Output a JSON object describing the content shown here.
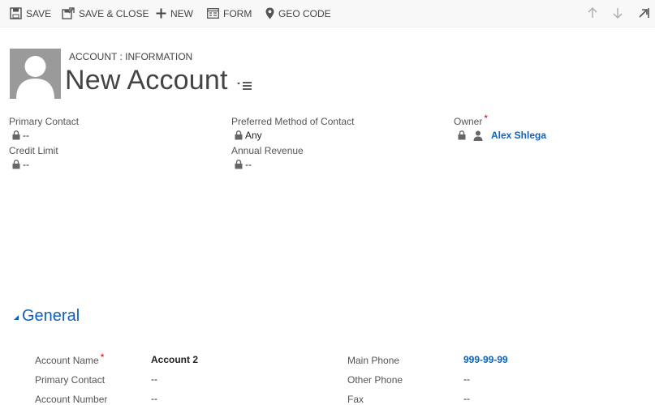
{
  "toolbar": {
    "save": "SAVE",
    "save_close": "SAVE & CLOSE",
    "new": "NEW",
    "form": "FORM",
    "geo_code": "GEO CODE"
  },
  "header": {
    "entity_label": "ACCOUNT : INFORMATION",
    "title": "New Account",
    "fields": {
      "primary_contact": {
        "label": "Primary Contact",
        "value": "--"
      },
      "preferred_method": {
        "label": "Preferred Method of Contact",
        "value": "Any"
      },
      "owner": {
        "label": "Owner",
        "required": "*",
        "value": "Alex Shlega"
      },
      "credit_limit": {
        "label": "Credit Limit",
        "value": "--"
      },
      "annual_revenue": {
        "label": "Annual Revenue",
        "value": "--"
      }
    }
  },
  "section": {
    "title": "General",
    "fields": {
      "account_name": {
        "label": "Account Name",
        "required": "*",
        "value": "Account 2"
      },
      "primary_contact": {
        "label": "Primary Contact",
        "value": "--"
      },
      "account_number": {
        "label": "Account Number",
        "value": "--"
      },
      "main_phone": {
        "label": "Main Phone",
        "value": "999-99-99"
      },
      "other_phone": {
        "label": "Other Phone",
        "value": "--"
      },
      "fax": {
        "label": "Fax",
        "value": "--"
      }
    }
  },
  "colors": {
    "accent": "#1160b7",
    "required": "#cc0000",
    "toolbar_bg": "#f8f8f8",
    "avatar_bg": "#9a9a9a"
  }
}
